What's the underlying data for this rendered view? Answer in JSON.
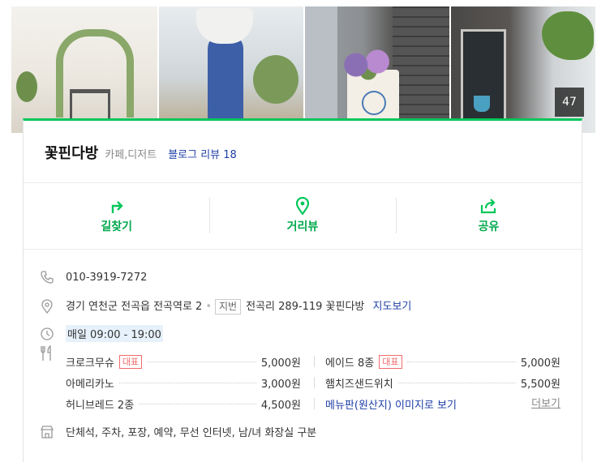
{
  "photo_count": "47",
  "place": {
    "name": "꽃핀다방",
    "category": "카페,디저트",
    "review": "블로그 리뷰 18"
  },
  "actions": [
    {
      "label": "길찾기",
      "icon": "route-icon"
    },
    {
      "label": "거리뷰",
      "icon": "location-pin-icon"
    },
    {
      "label": "공유",
      "icon": "share-icon"
    }
  ],
  "info": {
    "phone": "010-3919-7272",
    "address": "경기 연천군 전곡읍 전곡역로 2",
    "jibun_label": "지번",
    "jibun_address": "전곡리 289-119 꽃핀다방",
    "map_link": "지도보기",
    "hours": "매일 09:00 - 19:00",
    "facilities": "단체석, 주차, 포장, 예약, 무선 인터넷, 남/녀 화장실 구분"
  },
  "menu": {
    "badge": "대표",
    "items": [
      {
        "name": "크로크무슈",
        "price": "5,000원"
      },
      {
        "name": "에이드 8종",
        "price": "5,000원"
      },
      {
        "name": "아메리카노",
        "price": "3,000원"
      },
      {
        "name": "햄치즈샌드위치",
        "price": "5,500원"
      },
      {
        "name": "허니브레드 2종",
        "price": "4,500원"
      }
    ],
    "menu_image_link": "메뉴판(원산지) 이미지로 보기",
    "more": "더보기"
  },
  "colors": {
    "accent_green": "#03c75a",
    "link_blue": "#1e3ea6",
    "badge_red": "#f26b6b"
  }
}
